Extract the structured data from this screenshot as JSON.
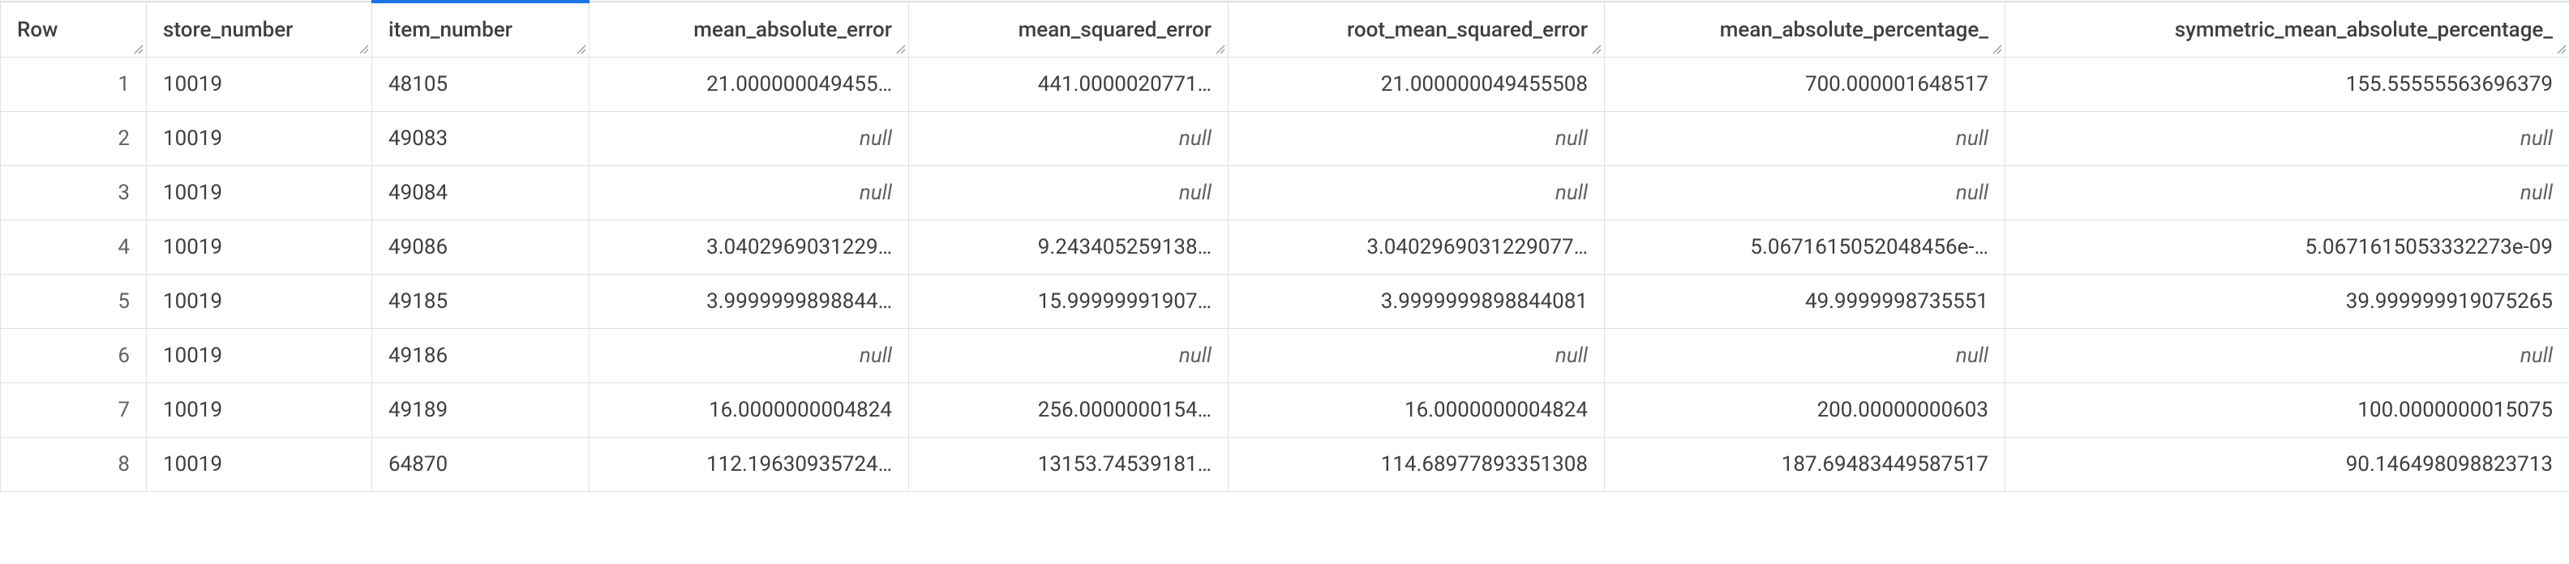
{
  "columns": [
    {
      "key": "row",
      "label": "Row",
      "class": "col-row",
      "interactable": true,
      "active": false
    },
    {
      "key": "store",
      "label": "store_number",
      "class": "col-store",
      "interactable": true,
      "active": false
    },
    {
      "key": "item",
      "label": "item_number",
      "class": "col-item",
      "interactable": true,
      "active": true
    },
    {
      "key": "mae",
      "label": "mean_absolute_error",
      "class": "col-mae",
      "interactable": true,
      "active": false
    },
    {
      "key": "mse",
      "label": "mean_squared_error",
      "class": "col-mse",
      "interactable": true,
      "active": false
    },
    {
      "key": "rmse",
      "label": "root_mean_squared_error",
      "class": "col-rmse",
      "interactable": true,
      "active": false
    },
    {
      "key": "mape",
      "label": "mean_absolute_percentage_",
      "class": "col-mape",
      "interactable": true,
      "active": false
    },
    {
      "key": "smape",
      "label": "symmetric_mean_absolute_percentage_",
      "class": "col-smape",
      "interactable": true,
      "active": false
    }
  ],
  "null_label": "null",
  "rows": [
    {
      "row": "1",
      "store": "10019",
      "item": "48105",
      "mae": "21.000000049455…",
      "mse": "441.0000020771…",
      "rmse": "21.000000049455508",
      "mape": "700.000001648517",
      "smape": "155.55555563696379"
    },
    {
      "row": "2",
      "store": "10019",
      "item": "49083",
      "mae": null,
      "mse": null,
      "rmse": null,
      "mape": null,
      "smape": null
    },
    {
      "row": "3",
      "store": "10019",
      "item": "49084",
      "mae": null,
      "mse": null,
      "rmse": null,
      "mape": null,
      "smape": null
    },
    {
      "row": "4",
      "store": "10019",
      "item": "49086",
      "mae": "3.0402969031229…",
      "mse": "9.243405259138…",
      "rmse": "3.0402969031229077…",
      "mape": "5.0671615052048456e-…",
      "smape": "5.0671615053332273e-09"
    },
    {
      "row": "5",
      "store": "10019",
      "item": "49185",
      "mae": "3.9999999898844…",
      "mse": "15.99999991907…",
      "rmse": "3.9999999898844081",
      "mape": "49.9999998735551",
      "smape": "39.999999919075265"
    },
    {
      "row": "6",
      "store": "10019",
      "item": "49186",
      "mae": null,
      "mse": null,
      "rmse": null,
      "mape": null,
      "smape": null
    },
    {
      "row": "7",
      "store": "10019",
      "item": "49189",
      "mae": "16.0000000004824",
      "mse": "256.0000000154…",
      "rmse": "16.0000000004824",
      "mape": "200.00000000603",
      "smape": "100.0000000015075"
    },
    {
      "row": "8",
      "store": "10019",
      "item": "64870",
      "mae": "112.19630935724…",
      "mse": "13153.74539181…",
      "rmse": "114.68977893351308",
      "mape": "187.69483449587517",
      "smape": "90.146498098823713"
    }
  ]
}
